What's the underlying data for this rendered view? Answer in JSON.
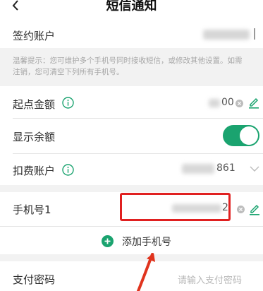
{
  "header": {
    "title": "短信通知",
    "back_icon": "chevron-left-icon"
  },
  "account_row": {
    "label": "签约账户"
  },
  "tip": {
    "line1": "温馨提示：您可维护多个手机号同时接收短信，或修改其他设置。如需",
    "line2": "注销，您可清空下列所有手机号。"
  },
  "start_amount_row": {
    "label": "起点金额",
    "value_tail": "00"
  },
  "show_balance_row": {
    "label": "显示余额",
    "toggle_on": true,
    "toggle_color": "#1aa36f"
  },
  "fee_account_row": {
    "label": "扣费账户",
    "value_tail": "861"
  },
  "phone_row": {
    "label": "手机号1",
    "value_tail": "2"
  },
  "add_phone": {
    "label": "添加手机号"
  },
  "pay_password_row": {
    "label": "支付密码",
    "placeholder": "请输入支付密码"
  },
  "colors": {
    "accent": "#1aa36f",
    "highlight_box": "#e02020",
    "arrow": "#e0341e"
  }
}
